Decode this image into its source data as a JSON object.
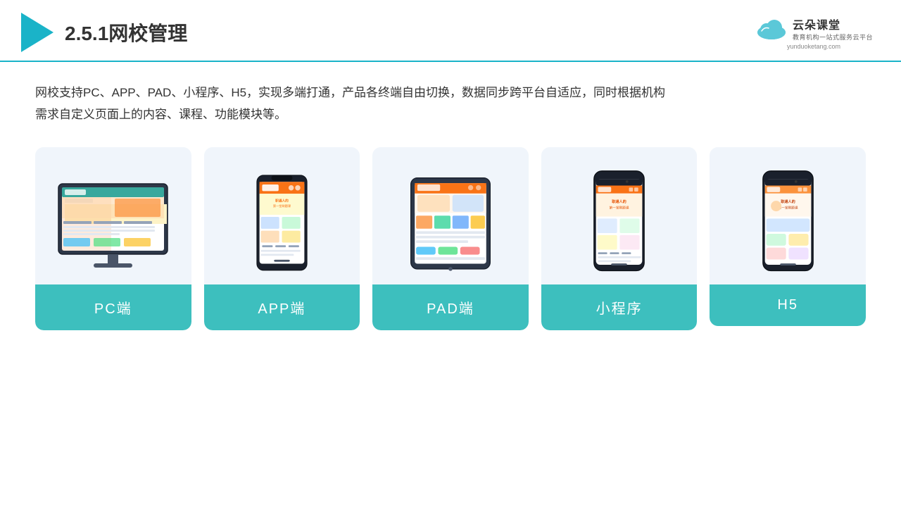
{
  "header": {
    "title": "2.5.1网校管理",
    "brand_name": "云朵课堂",
    "brand_tagline": "教育机构一站\n式服务云平台",
    "brand_url": "yunduoketang.com"
  },
  "description": "网校支持PC、APP、PAD、小程序、H5，实现多端打通，产品各终端自由切换，数据同步跨平台自适应，同时根据机构\n需求自定义页面上的内容、课程、功能模块等。",
  "cards": [
    {
      "id": "pc",
      "label": "PC端"
    },
    {
      "id": "app",
      "label": "APP端"
    },
    {
      "id": "pad",
      "label": "PAD端"
    },
    {
      "id": "miniprogram",
      "label": "小程序"
    },
    {
      "id": "h5",
      "label": "H5"
    }
  ],
  "colors": {
    "accent": "#3dbfbe",
    "header_border": "#1ab3c8",
    "card_bg": "#f0f5fb"
  }
}
